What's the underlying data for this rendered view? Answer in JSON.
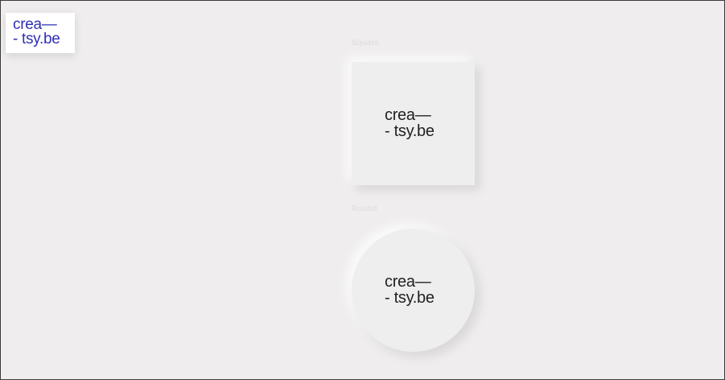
{
  "brand": {
    "line1": "crea—",
    "line2": "- tsy.be",
    "color": "#2f2fb5"
  },
  "sections": {
    "square": {
      "label": "Square",
      "logo_line1": "crea—",
      "logo_line2": "- tsy.be"
    },
    "round": {
      "label": "Round",
      "logo_line1": "crea—",
      "logo_line2": "- tsy.be"
    }
  },
  "colors": {
    "background": "#efeded",
    "logo_text": "#222222",
    "label_text": "#e3e0e0"
  }
}
